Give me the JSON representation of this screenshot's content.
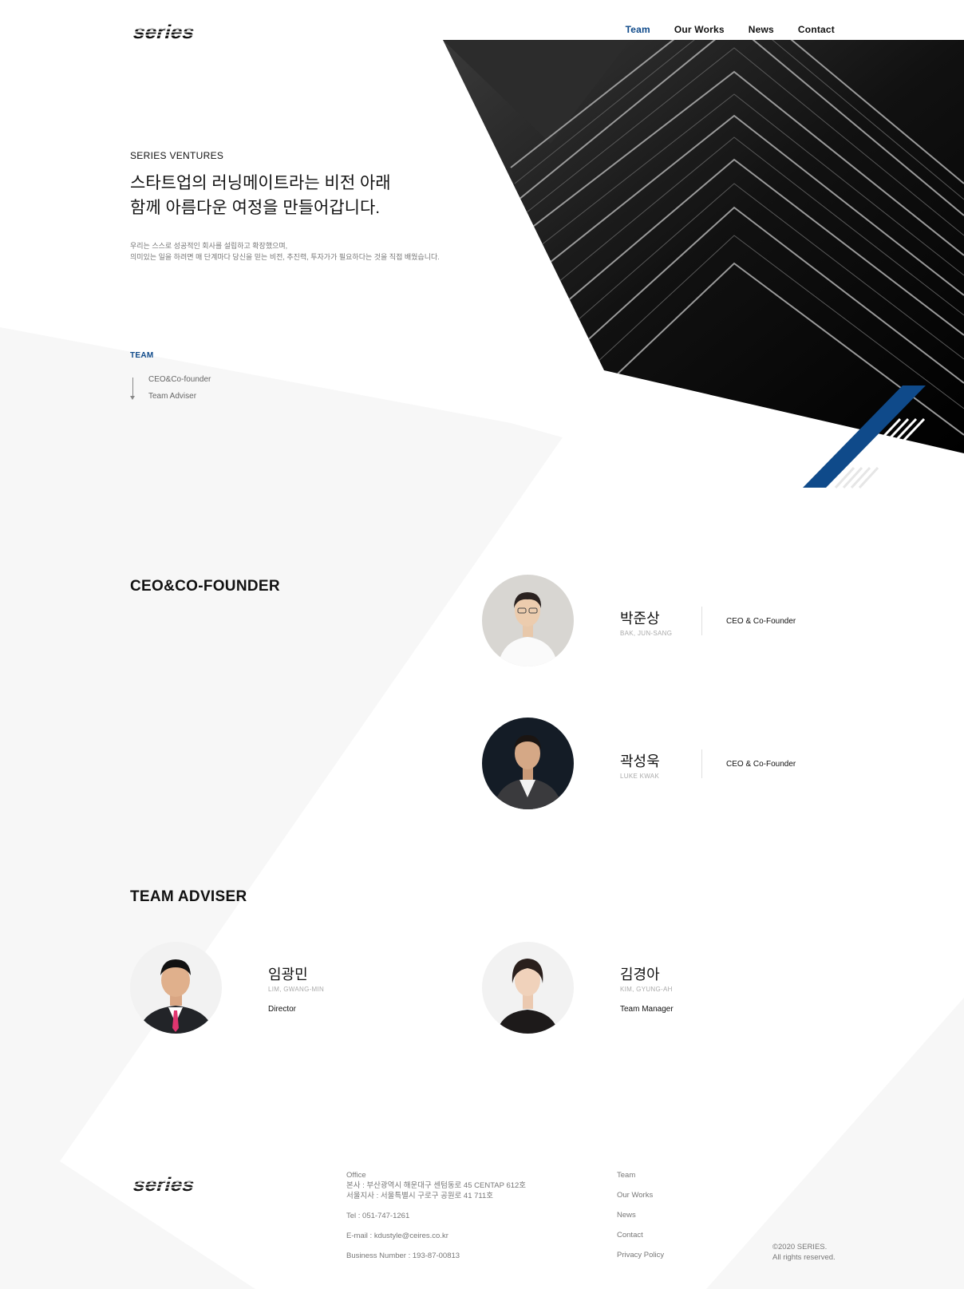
{
  "header": {
    "logo_text": "series",
    "nav": [
      {
        "label": "Team",
        "active": true
      },
      {
        "label": "Our Works",
        "active": false
      },
      {
        "label": "News",
        "active": false
      },
      {
        "label": "Contact",
        "active": false
      }
    ]
  },
  "hero": {
    "brand": "SERIES VENTURES",
    "title_line1": "스타트업의 러닝메이트라는 비전 아래",
    "title_line2": "함께 아름다운 여정을 만들어갑니다.",
    "desc_line1": "우리는 스스로 성공적인 회사를 설립하고 확장했으며,",
    "desc_line2": "의미있는 일을 하려면 매 단계마다 당신을 믿는 비전, 추진력, 투자가가 필요하다는 것을 직접 배웠습니다."
  },
  "team_nav": {
    "label": "TEAM",
    "links": [
      "CEO&Co-founder",
      "Team Adviser"
    ]
  },
  "ceo_section": {
    "title": "CEO&CO-FOUNDER",
    "members": [
      {
        "name": "박준상",
        "name_en": "BAK, JUN-SANG",
        "role": "CEO & Co-Founder"
      },
      {
        "name": "곽성욱",
        "name_en": "LUKE KWAK",
        "role": "CEO & Co-Founder"
      }
    ]
  },
  "adviser_section": {
    "title": "TEAM ADVISER",
    "members": [
      {
        "name": "임광민",
        "name_en": "LIM, GWANG-MIN",
        "role": "Director"
      },
      {
        "name": "김경아",
        "name_en": "KIM, GYUNG-AH",
        "role": "Team Manager"
      }
    ]
  },
  "footer": {
    "office_label": "Office",
    "office_line1": "본사 : 부산광역시 해운대구 센텀동로 45 CENTAP 612호",
    "office_line2": "서울지사 : 서울특별시 구로구 공원로 41 711호",
    "tel": "Tel : 051-747-1261",
    "email": "E-mail : kdustyle@ceires.co.kr",
    "business_number": "Business Number : 193-87-00813",
    "links": [
      "Team",
      "Our Works",
      "News",
      "Contact",
      "Privacy Policy"
    ],
    "copyright_line1": "©2020 SERIES.",
    "copyright_line2": "All rights reserved."
  },
  "colors": {
    "accent_blue": "#0f4a8a",
    "dark": "#111111",
    "bg_shape": "#f7f7f7"
  }
}
